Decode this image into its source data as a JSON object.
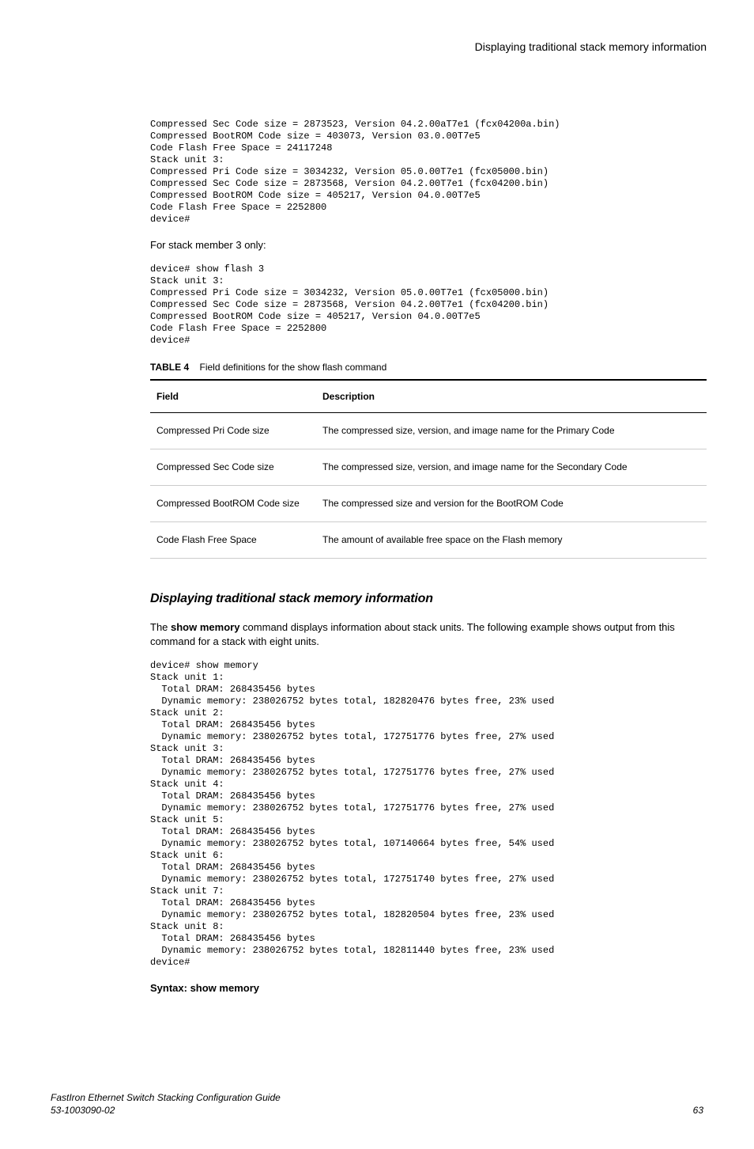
{
  "header": {
    "title": "Displaying traditional stack memory information"
  },
  "code1": "Compressed Sec Code size = 2873523, Version 04.2.00aT7e1 (fcx04200a.bin)\nCompressed BootROM Code size = 403073, Version 03.0.00T7e5\nCode Flash Free Space = 24117248\nStack unit 3:\nCompressed Pri Code size = 3034232, Version 05.0.00T7e1 (fcx05000.bin)\nCompressed Sec Code size = 2873568, Version 04.2.00T7e1 (fcx04200.bin)\nCompressed BootROM Code size = 405217, Version 04.0.00T7e5\nCode Flash Free Space = 2252800\ndevice#",
  "intro1": "For stack member 3 only:",
  "code2": "device# show flash 3\nStack unit 3:\nCompressed Pri Code size = 3034232, Version 05.0.00T7e1 (fcx05000.bin)\nCompressed Sec Code size = 2873568, Version 04.2.00T7e1 (fcx04200.bin)\nCompressed BootROM Code size = 405217, Version 04.0.00T7e5\nCode Flash Free Space = 2252800\ndevice#",
  "table": {
    "caption_label": "TABLE 4",
    "caption_text": "Field definitions for the show flash command",
    "headers": {
      "field": "Field",
      "description": "Description"
    },
    "rows": [
      {
        "field": "Compressed Pri Code size",
        "description": "The compressed size, version, and image name for the Primary Code"
      },
      {
        "field": "Compressed Sec Code size",
        "description": "The compressed size, version, and image name for the Secondary Code"
      },
      {
        "field": "Compressed BootROM Code size",
        "description": "The compressed size and version for the BootROM Code"
      },
      {
        "field": "Code Flash Free Space",
        "description": "The amount of available free space on the Flash memory"
      }
    ]
  },
  "section": {
    "heading": "Displaying traditional stack memory information",
    "intro_pre": "The ",
    "intro_cmd": "show memory",
    "intro_post": " command displays information about stack units. The following example shows output from this command for a stack with eight units."
  },
  "code3": "device# show memory\nStack unit 1:\n  Total DRAM: 268435456 bytes\n  Dynamic memory: 238026752 bytes total, 182820476 bytes free, 23% used\nStack unit 2:\n  Total DRAM: 268435456 bytes\n  Dynamic memory: 238026752 bytes total, 172751776 bytes free, 27% used\nStack unit 3:\n  Total DRAM: 268435456 bytes\n  Dynamic memory: 238026752 bytes total, 172751776 bytes free, 27% used\nStack unit 4:\n  Total DRAM: 268435456 bytes\n  Dynamic memory: 238026752 bytes total, 172751776 bytes free, 27% used\nStack unit 5:\n  Total DRAM: 268435456 bytes\n  Dynamic memory: 238026752 bytes total, 107140664 bytes free, 54% used\nStack unit 6:\n  Total DRAM: 268435456 bytes\n  Dynamic memory: 238026752 bytes total, 172751740 bytes free, 27% used\nStack unit 7:\n  Total DRAM: 268435456 bytes\n  Dynamic memory: 238026752 bytes total, 182820504 bytes free, 23% used\nStack unit 8:\n  Total DRAM: 268435456 bytes\n  Dynamic memory: 238026752 bytes total, 182811440 bytes free, 23% used\ndevice#",
  "syntax": "Syntax: show memory",
  "footer": {
    "left_line1": "FastIron Ethernet Switch Stacking Configuration Guide",
    "left_line2": "53-1003090-02",
    "right": "63"
  }
}
